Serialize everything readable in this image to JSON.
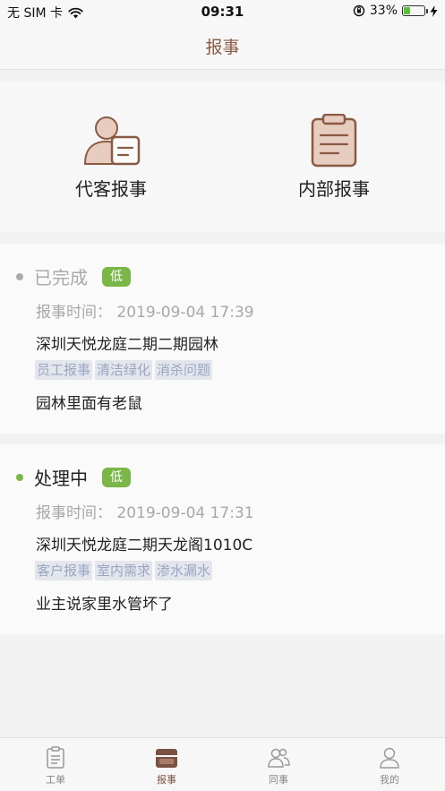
{
  "status_bar": {
    "carrier": "无 SIM 卡",
    "time": "09:31",
    "battery": "33%",
    "battery_level": 0.33
  },
  "nav": {
    "title": "报事"
  },
  "quick_actions": [
    {
      "label": "代客报事",
      "icon": "customer-report-icon"
    },
    {
      "label": "内部报事",
      "icon": "clipboard-icon"
    }
  ],
  "reports": [
    {
      "status": "已完成",
      "status_color": "#aaaaaa",
      "dot_color": "#aaaaaa",
      "priority": "低",
      "time": "报事时间：  2019-09-04 17:39",
      "address": "深圳天悦龙庭二期二期园林",
      "tags": [
        "员工报事",
        "清洁绿化",
        "消杀问题"
      ],
      "description": "园林里面有老鼠"
    },
    {
      "status": "处理中",
      "status_color": "#222222",
      "dot_color": "#7ab648",
      "priority": "低",
      "time": "报事时间：  2019-09-04 17:31",
      "address": "深圳天悦龙庭二期天龙阁1010C",
      "tags": [
        "客户报事",
        "室内需求",
        "渗水漏水"
      ],
      "description": "业主说家里水管坏了"
    }
  ],
  "tabs": [
    {
      "label": "工单",
      "icon": "work-order-icon"
    },
    {
      "label": "报事",
      "icon": "report-icon",
      "active": true
    },
    {
      "label": "同事",
      "icon": "colleagues-icon"
    },
    {
      "label": "我的",
      "icon": "profile-icon"
    }
  ],
  "colors": {
    "accent": "#8a5a44",
    "priority_low": "#7ab648"
  }
}
